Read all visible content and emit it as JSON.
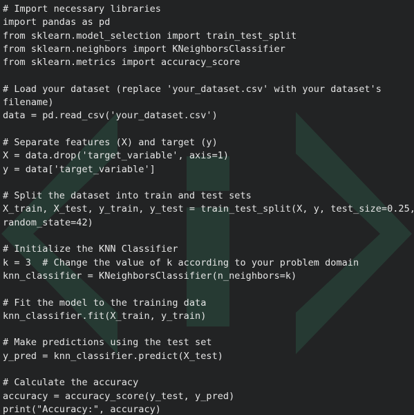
{
  "editor": {
    "background": "#222324",
    "text_color": "#e6e6e6",
    "watermark_color": "#263a33",
    "watermark_icon": "code-brackets-logo",
    "lines": [
      "# Import necessary libraries",
      "import pandas as pd",
      "from sklearn.model_selection import train_test_split",
      "from sklearn.neighbors import KNeighborsClassifier",
      "from sklearn.metrics import accuracy_score",
      "",
      "# Load your dataset (replace 'your_dataset.csv' with your dataset's",
      "filename)",
      "data = pd.read_csv('your_dataset.csv')",
      "",
      "# Separate features (X) and target (y)",
      "X = data.drop('target_variable', axis=1)",
      "y = data['target_variable']",
      "",
      "# Split the dataset into train and test sets",
      "X_train, X_test, y_train, y_test = train_test_split(X, y, test_size=0.25,",
      "random_state=42)",
      "",
      "# Initialize the KNN Classifier",
      "k = 3  # Change the value of k according to your problem domain",
      "knn_classifier = KNeighborsClassifier(n_neighbors=k)",
      "",
      "# Fit the model to the training data",
      "knn_classifier.fit(X_train, y_train)",
      "",
      "# Make predictions using the test set",
      "y_pred = knn_classifier.predict(X_test)",
      "",
      "# Calculate the accuracy",
      "accuracy = accuracy_score(y_test, y_pred)",
      "print(\"Accuracy:\", accuracy)"
    ]
  }
}
